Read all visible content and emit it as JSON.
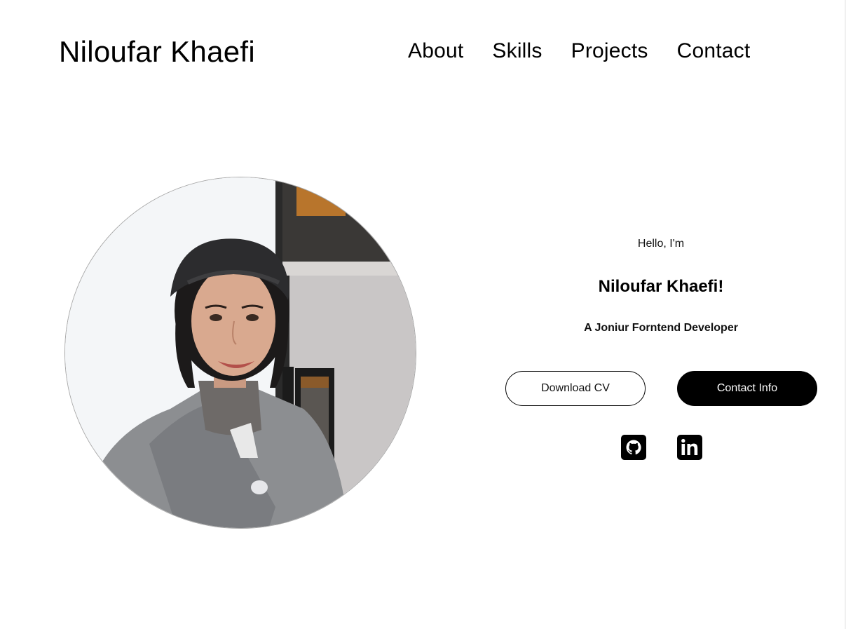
{
  "header": {
    "logo": "Niloufar Khaefi",
    "nav": [
      {
        "label": "About"
      },
      {
        "label": "Skills"
      },
      {
        "label": "Projects"
      },
      {
        "label": "Contact"
      }
    ]
  },
  "hero": {
    "greeting": "Hello, I'm",
    "name": "Niloufar Khaefi!",
    "role": "A Joniur Forntend Developer",
    "buttons": {
      "download_cv": "Download CV",
      "contact_info": "Contact Info"
    },
    "socials": [
      {
        "icon": "github-icon"
      },
      {
        "icon": "linkedin-icon"
      }
    ],
    "photo": {
      "icon": "profile-photo"
    }
  },
  "colors": {
    "background": "#ffffff",
    "text": "#000000",
    "button_solid": "#000000",
    "button_solid_text": "#ffffff"
  }
}
